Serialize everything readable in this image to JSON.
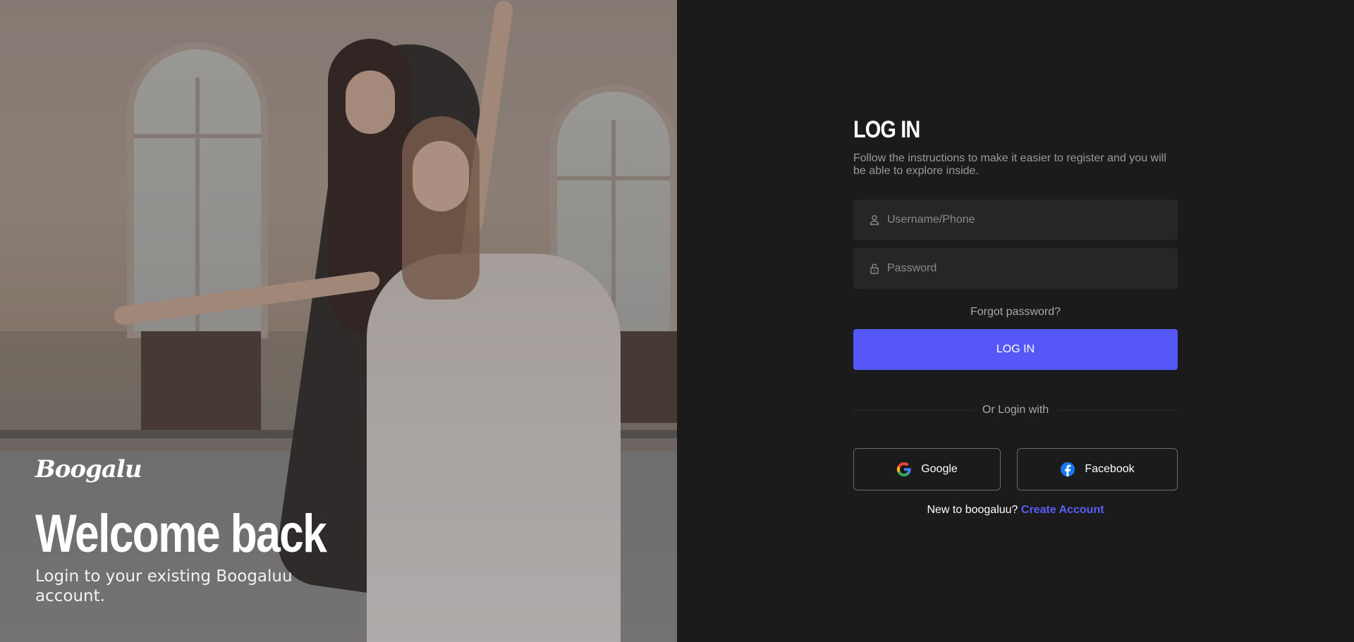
{
  "hero": {
    "brand": "Boogalu",
    "welcome": "Welcome back",
    "subtitle": "Login to your existing Boogaluu account."
  },
  "form": {
    "title": "LOG IN",
    "description": "Follow the instructions to make it easier to register and you will be able to explore inside.",
    "username_placeholder": "Username/Phone",
    "password_placeholder": "Password",
    "forgot_label": "Forgot password?",
    "login_label": "LOG IN",
    "divider_label": "Or Login with",
    "google_label": "Google",
    "facebook_label": "Facebook",
    "signup_prompt": "New to boogaluu?",
    "signup_link": "Create Account"
  },
  "colors": {
    "accent": "#5558f7",
    "background": "#1b1b1b",
    "field": "#262626"
  }
}
